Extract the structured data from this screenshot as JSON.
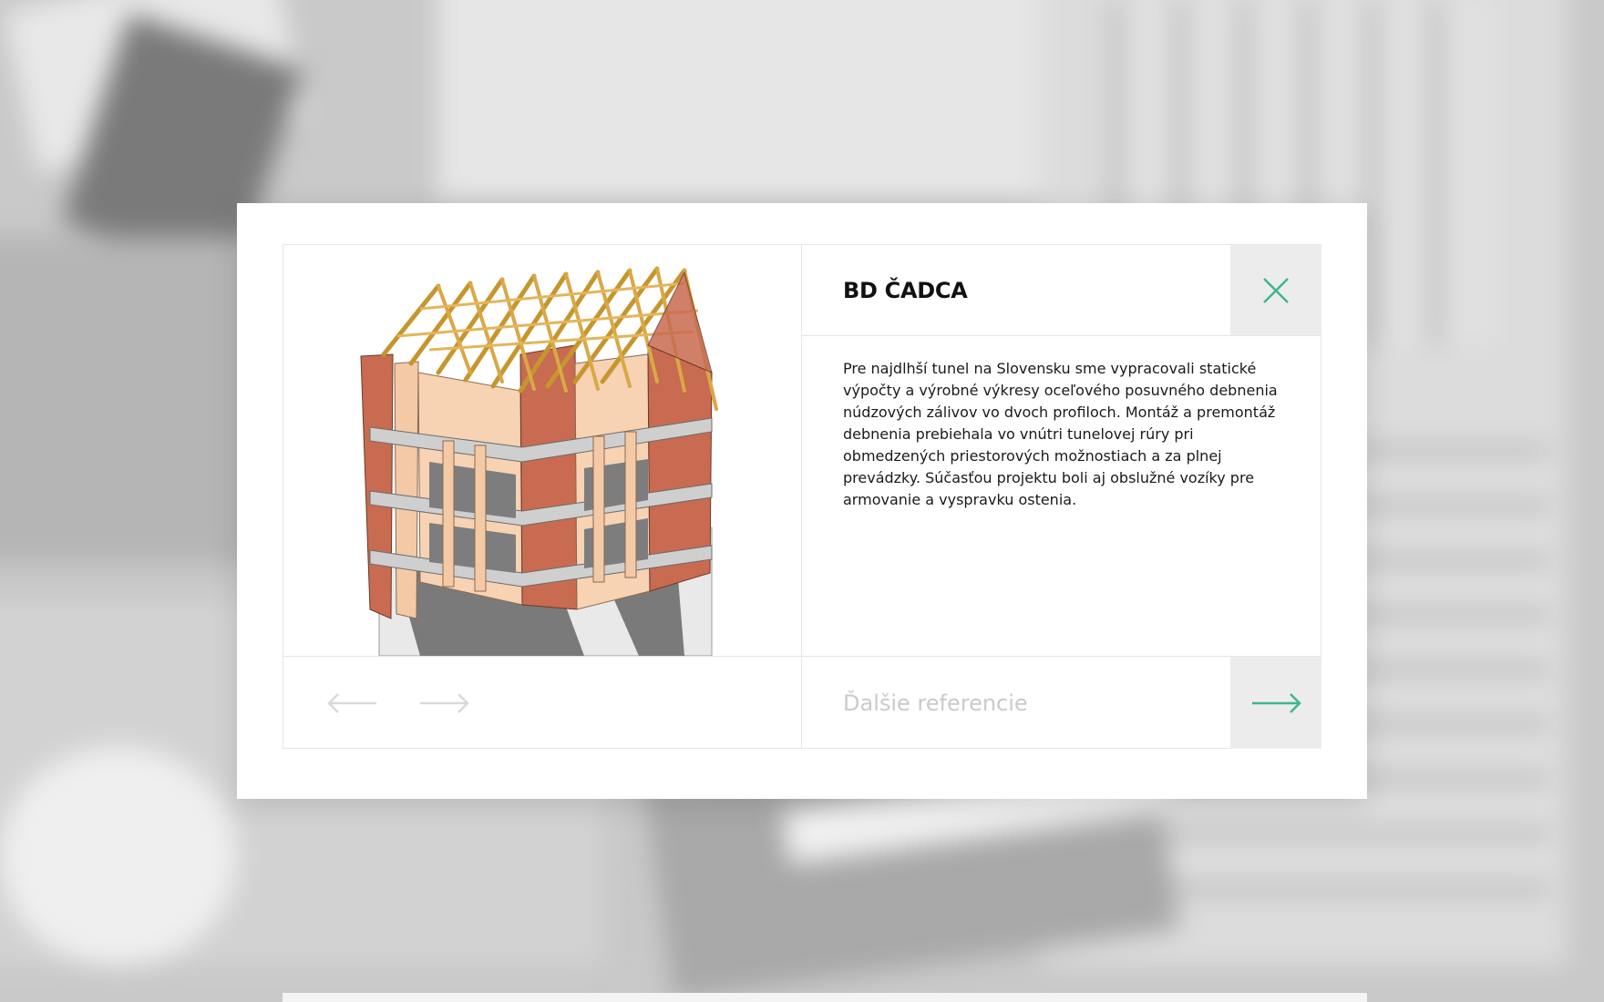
{
  "modal": {
    "title": "BD ČADCA",
    "description": "Pre najdlhší tunel na Slovensku sme vypracovali statické výpočty a výrobné výkresy oceľového posuvného debnenia núdzových zálivov vo dvoch profiloch. Montáž a premontáž debnenia prebiehala vo vnútri tunelovej rúry pri obmedzených priestorových možnostiach a za plnej prevádzky. Súčasťou projektu boli aj obslužné vozíky pre armovanie a vyspravku ostenia.",
    "image": {
      "icon": "building-3d-model-image"
    },
    "close_icon": "close-icon",
    "nav": {
      "prev_icon": "arrow-left-icon",
      "next_icon": "arrow-right-icon"
    },
    "more_references": {
      "label": "Ďalšie referencie",
      "icon": "arrow-right-icon"
    }
  },
  "colors": {
    "accent": "#3fb58e",
    "muted_arrow": "#d9d9d9",
    "muted_text": "#c8ccc6",
    "cell_gray": "#ececec",
    "border": "#e6e6e6"
  }
}
